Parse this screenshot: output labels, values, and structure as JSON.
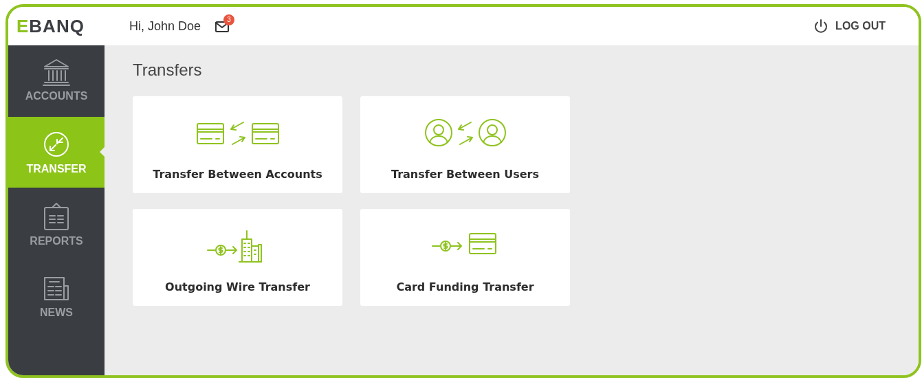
{
  "header": {
    "logo": "EBANQ",
    "greeting": "Hi, John Doe",
    "unread_count": "3",
    "logout": "LOG OUT"
  },
  "sidebar": {
    "items": [
      {
        "kind": "bank",
        "label": "ACCOUNTS",
        "selected": false
      },
      {
        "kind": "transfer",
        "label": "TRANSFER",
        "selected": true
      },
      {
        "kind": "clipboard",
        "label": "REPORTS",
        "selected": false
      },
      {
        "kind": "newspaper",
        "label": "NEWS",
        "selected": false
      }
    ]
  },
  "page_title": "Transfers",
  "options": [
    {
      "kind": "cards-exchange",
      "label": "Transfer Between Accounts"
    },
    {
      "kind": "users-exchange",
      "label": "Transfer Between Users"
    },
    {
      "kind": "money-to-building",
      "label": "Outgoing Wire Transfer"
    },
    {
      "kind": "money-to-card",
      "label": "Card Funding Transfer"
    }
  ]
}
